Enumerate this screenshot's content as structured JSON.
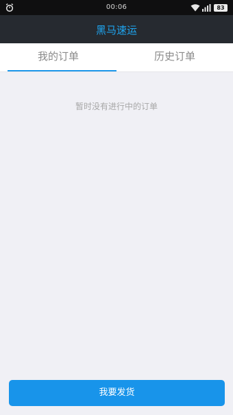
{
  "status_bar": {
    "time": "00:06",
    "battery": "83",
    "icons": [
      "alarm-icon",
      "wifi-icon",
      "signal-icon",
      "battery-icon"
    ]
  },
  "nav": {
    "title": "黑马速运",
    "title_color": "#1ea5f0",
    "background": "#262a30"
  },
  "tabs": [
    {
      "label": "我的订单",
      "active": true
    },
    {
      "label": "历史订单",
      "active": false
    }
  ],
  "main": {
    "empty_message": "暂时没有进行中的订单"
  },
  "actions": {
    "ship_label": "我要发货",
    "accent": "#1894ea"
  }
}
